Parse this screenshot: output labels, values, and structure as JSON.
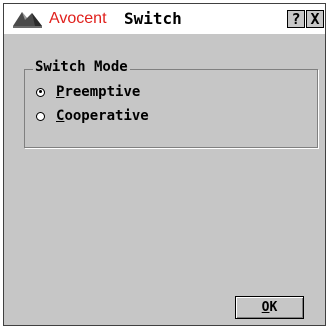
{
  "window": {
    "brand": "Avocent",
    "title": "Switch",
    "help_label": "?",
    "close_label": "X"
  },
  "group": {
    "legend": "Switch Mode",
    "options": [
      {
        "label_first": "P",
        "label_rest": "reemptive",
        "selected": true
      },
      {
        "label_first": "C",
        "label_rest": "ooperative",
        "selected": false
      }
    ]
  },
  "buttons": {
    "ok_first": "O",
    "ok_rest": "K"
  },
  "colors": {
    "brand": "#e0201c",
    "panel": "#c6c6c6"
  },
  "icons": {
    "logo": "avocent-logo-icon"
  }
}
